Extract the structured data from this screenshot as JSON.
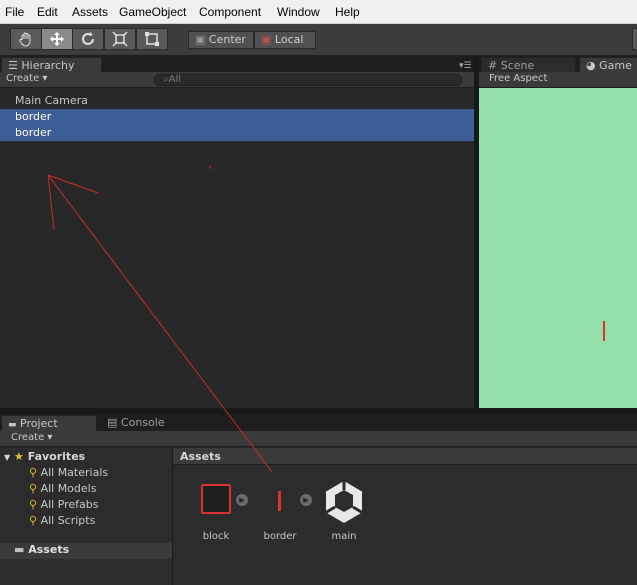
{
  "menu": [
    "File",
    "Edit",
    "Assets",
    "GameObject",
    "Component",
    "Window",
    "Help"
  ],
  "toolbar": {
    "tools": [
      "hand-icon",
      "move-icon",
      "rotate-icon",
      "scale-icon",
      "rect-icon"
    ],
    "center_label": "Center",
    "local_label": "Local"
  },
  "hierarchy": {
    "tab_label": "Hierarchy",
    "create_label": "Create",
    "search_placeholder": "All",
    "items": [
      {
        "label": "Main Camera",
        "selected": false
      },
      {
        "label": "border",
        "selected": true
      },
      {
        "label": "border",
        "selected": true
      }
    ]
  },
  "scene": {
    "tab_label": "Scene"
  },
  "game": {
    "tab_label": "Game",
    "aspect_label": "Free Aspect",
    "background": "#92dfaa"
  },
  "project": {
    "tab_label": "Project",
    "console_label": "Console",
    "create_label": "Create",
    "favorites_label": "Favorites",
    "favorites": [
      "All Materials",
      "All Models",
      "All Prefabs",
      "All Scripts"
    ],
    "assets_folder_label": "Assets",
    "assets_header": "Assets",
    "assets": [
      {
        "name": "block",
        "icon": "sprite-square-icon"
      },
      {
        "name": "border",
        "icon": "sprite-line-icon"
      },
      {
        "name": "main",
        "icon": "unity-logo-icon"
      }
    ]
  },
  "colors": {
    "selection": "#3e5f96",
    "annotation": "#cc2a2a"
  }
}
